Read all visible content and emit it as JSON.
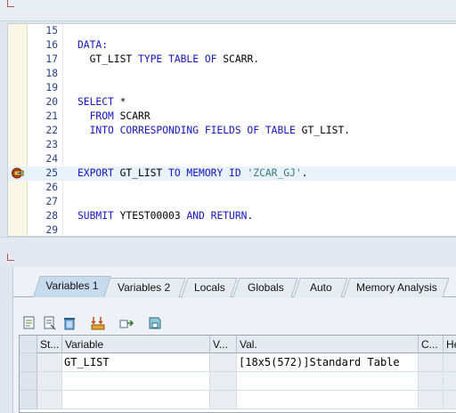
{
  "editor": {
    "lines": [
      {
        "no": "15",
        "tokens": []
      },
      {
        "no": "16",
        "tokens": [
          {
            "t": "DATA:",
            "c": "kw"
          }
        ]
      },
      {
        "no": "17",
        "tokens": [
          {
            "t": "  GT_LIST ",
            "c": "pl"
          },
          {
            "t": "TYPE TABLE OF",
            "c": "kw"
          },
          {
            "t": " SCARR.",
            "c": "pl"
          }
        ]
      },
      {
        "no": "18",
        "tokens": []
      },
      {
        "no": "19",
        "tokens": []
      },
      {
        "no": "20",
        "tokens": [
          {
            "t": "SELECT",
            "c": "kw"
          },
          {
            "t": " *",
            "c": "pl"
          }
        ]
      },
      {
        "no": "21",
        "tokens": [
          {
            "t": "  FROM",
            "c": "kw"
          },
          {
            "t": " SCARR",
            "c": "pl"
          }
        ]
      },
      {
        "no": "22",
        "tokens": [
          {
            "t": "  INTO CORRESPONDING FIELDS OF TABLE",
            "c": "kw"
          },
          {
            "t": " GT_LIST.",
            "c": "pl"
          }
        ]
      },
      {
        "no": "23",
        "tokens": []
      },
      {
        "no": "24",
        "tokens": []
      },
      {
        "no": "25",
        "tokens": [
          {
            "t": "EXPORT",
            "c": "kw"
          },
          {
            "t": " GT_LIST ",
            "c": "pl"
          },
          {
            "t": "TO MEMORY ID",
            "c": "kw"
          },
          {
            "t": " ",
            "c": "pl"
          },
          {
            "t": "'ZCAR_GJ'",
            "c": "str"
          },
          {
            "t": ".",
            "c": "pl"
          }
        ],
        "highlight": true,
        "breakpoint": true
      },
      {
        "no": "26",
        "tokens": []
      },
      {
        "no": "27",
        "tokens": []
      },
      {
        "no": "28",
        "tokens": [
          {
            "t": "SUBMIT",
            "c": "kw"
          },
          {
            "t": " YTEST00003 ",
            "c": "pl"
          },
          {
            "t": "AND RETURN",
            "c": "kw"
          },
          {
            "t": ".",
            "c": "pl"
          }
        ]
      },
      {
        "no": "29",
        "tokens": []
      }
    ]
  },
  "tabs": [
    "Variables 1",
    "Variables 2",
    "Locals",
    "Globals",
    "Auto",
    "Memory Analysis"
  ],
  "active_tab": "Variables 1",
  "toolbar_icons": [
    "select-all-icon",
    "detail-view-icon",
    "delete-icon",
    "transfer-icon",
    "move-variables-icon",
    "save-layout-icon"
  ],
  "grid": {
    "headers": [
      "St...",
      "Variable",
      "V...",
      "Val.",
      "C...",
      "He"
    ],
    "rows": [
      {
        "status": "",
        "variable": "GT_LIST",
        "v": "",
        "value": "[18x5(572)]Standard Table",
        "c": "",
        "he": ""
      },
      {
        "status": "",
        "variable": "",
        "v": "",
        "value": "",
        "c": "",
        "he": ""
      },
      {
        "status": "",
        "variable": "",
        "v": "",
        "value": "",
        "c": "",
        "he": ""
      }
    ]
  },
  "colors": {
    "keyword": "#1414c8",
    "string": "#3a7a7a",
    "line_number": "#27408b",
    "highlight_row": "#e8f2fb",
    "active_tab": "#c7dbee"
  }
}
